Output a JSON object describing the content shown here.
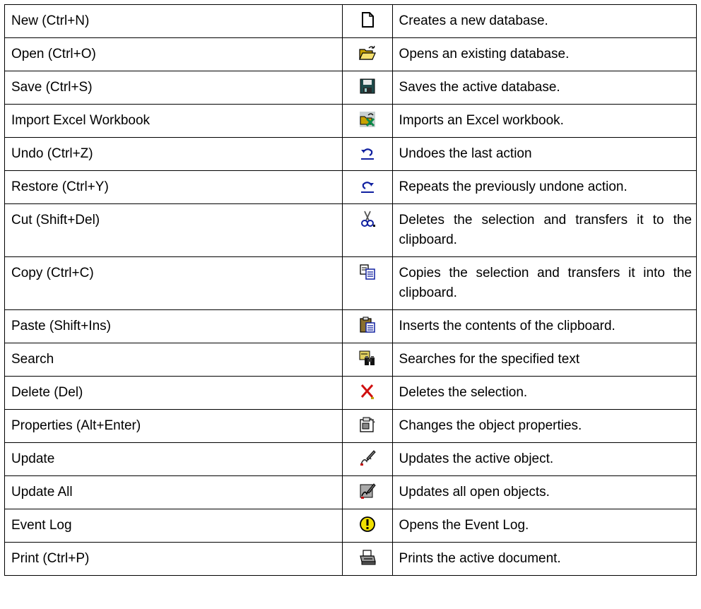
{
  "rows": [
    {
      "command": "New (Ctrl+N)",
      "icon": "new-document-icon",
      "description": "Creates a new database."
    },
    {
      "command": "Open (Ctrl+O)",
      "icon": "open-folder-icon",
      "description": "Opens an existing database."
    },
    {
      "command": "Save (Ctrl+S)",
      "icon": "save-disk-icon",
      "description": "Saves the active database."
    },
    {
      "command": "Import Excel Workbook",
      "icon": "import-excel-icon",
      "description": "Imports an Excel workbook."
    },
    {
      "command": "Undo (Ctrl+Z)",
      "icon": "undo-arrow-icon",
      "description": "Undoes the last action"
    },
    {
      "command": "Restore (Ctrl+Y)",
      "icon": "redo-arrow-icon",
      "description": "Repeats the previously undone action."
    },
    {
      "command": "Cut (Shift+Del)",
      "icon": "scissors-icon",
      "description": "Deletes the selection and transfers it to the clipboard."
    },
    {
      "command": "Copy (Ctrl+C)",
      "icon": "copy-pages-icon",
      "description": "Copies the selection and transfers it into the clipboard."
    },
    {
      "command": "Paste (Shift+Ins)",
      "icon": "clipboard-paste-icon",
      "description": "Inserts the contents of the clipboard."
    },
    {
      "command": "Search",
      "icon": "binoculars-search-icon",
      "description": "Searches for the specified text"
    },
    {
      "command": "Delete (Del)",
      "icon": "red-x-delete-icon",
      "description": "Deletes the selection."
    },
    {
      "command": "Properties (Alt+Enter)",
      "icon": "properties-icon",
      "description": "Changes the object properties."
    },
    {
      "command": "Update",
      "icon": "update-pen-icon",
      "description": "Updates the active object."
    },
    {
      "command": "Update All",
      "icon": "update-all-icon",
      "description": "Updates all open objects."
    },
    {
      "command": "Event Log",
      "icon": "warning-exclamation-icon",
      "description": "Opens the Event Log."
    },
    {
      "command": "Print (Ctrl+P)",
      "icon": "printer-icon",
      "description": "Prints the active document."
    }
  ]
}
